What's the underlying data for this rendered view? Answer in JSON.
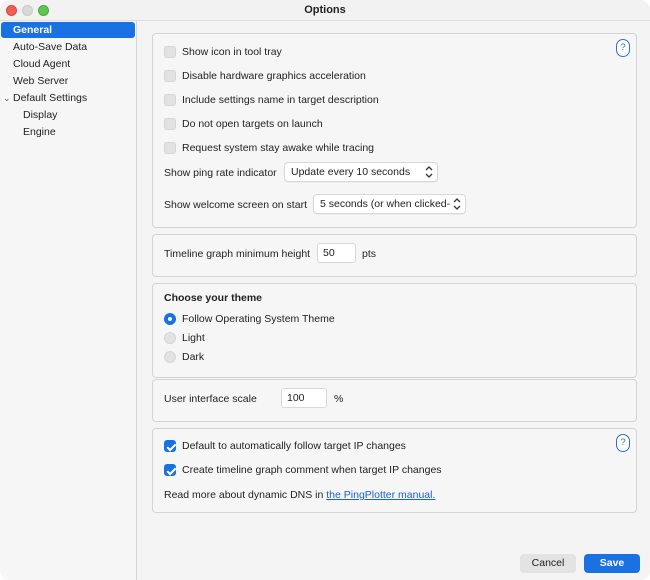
{
  "window": {
    "title": "Options"
  },
  "sidebar": {
    "items": [
      {
        "label": "General"
      },
      {
        "label": "Auto-Save Data"
      },
      {
        "label": "Cloud Agent"
      },
      {
        "label": "Web Server"
      },
      {
        "label": "Default Settings"
      },
      {
        "label": "Display"
      },
      {
        "label": "Engine"
      }
    ],
    "selected": "General"
  },
  "general": {
    "help_label": "?",
    "checkboxes": [
      {
        "label": "Show icon in tool tray",
        "checked": false
      },
      {
        "label": "Disable hardware graphics acceleration",
        "checked": false
      },
      {
        "label": "Include settings name in target description",
        "checked": false
      },
      {
        "label": "Do not open targets on launch",
        "checked": false
      },
      {
        "label": "Request system stay awake while tracing",
        "checked": false
      }
    ],
    "ping_rate": {
      "label": "Show ping rate indicator",
      "value": "Update every 10 seconds"
    },
    "welcome_screen": {
      "label": "Show welcome screen on start",
      "value": "5 seconds (or when clicked-"
    }
  },
  "timeline": {
    "label": "Timeline graph minimum height",
    "value": "50",
    "unit": "pts"
  },
  "theme": {
    "heading": "Choose your theme",
    "options": [
      {
        "label": "Follow Operating System Theme",
        "selected": true
      },
      {
        "label": "Light",
        "selected": false
      },
      {
        "label": "Dark",
        "selected": false
      }
    ]
  },
  "scale": {
    "label": "User interface scale",
    "value": "100",
    "unit": "%"
  },
  "ip": {
    "help_label": "?",
    "checkboxes": [
      {
        "label": "Default to automatically follow target IP changes",
        "checked": true
      },
      {
        "label": "Create timeline graph comment when target IP changes",
        "checked": true
      }
    ],
    "note_text": "Read more about dynamic DNS in ",
    "note_link": "the PingPlotter manual."
  },
  "footer": {
    "cancel_label": "Cancel",
    "save_label": "Save"
  },
  "colors": {
    "accent": "#1a71e2",
    "link": "#1a5fd6"
  }
}
